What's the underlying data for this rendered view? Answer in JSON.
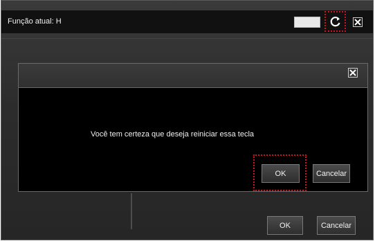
{
  "window": {
    "title": "Função atual: H",
    "reset_icon": "refresh-icon",
    "close_icon": "close-icon"
  },
  "dialog": {
    "message": "Você tem certeza que deseja reiniciar essa tecla",
    "ok_label": "OK",
    "cancel_label": "Cancelar",
    "close_icon": "close-icon"
  },
  "footer": {
    "ok_label": "OK",
    "cancel_label": "Cancelar"
  },
  "colors": {
    "highlight": "#d4141a",
    "panel_bg": "#000000",
    "title_bg": "#111111"
  }
}
